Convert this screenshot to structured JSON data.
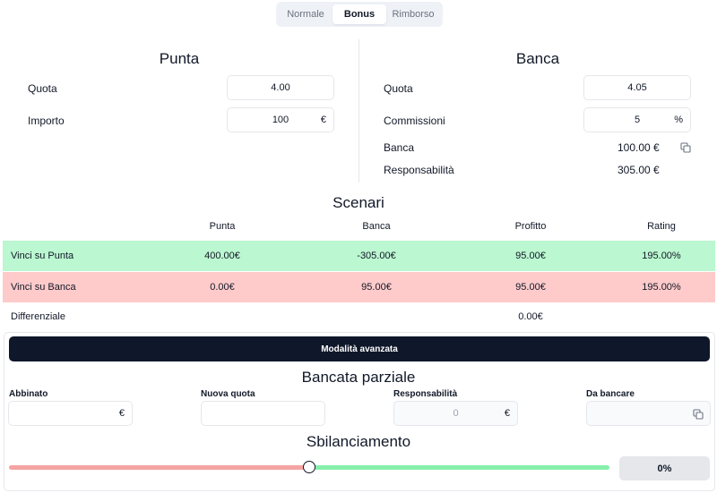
{
  "tabs": [
    {
      "label": "Normale",
      "active": false
    },
    {
      "label": "Bonus",
      "active": true
    },
    {
      "label": "Rimborso",
      "active": false
    }
  ],
  "punta": {
    "title": "Punta",
    "quota_label": "Quota",
    "quota_value": "4.00",
    "importo_label": "Importo",
    "importo_value": "100",
    "importo_suffix": "€"
  },
  "banca": {
    "title": "Banca",
    "quota_label": "Quota",
    "quota_value": "4.05",
    "commissioni_label": "Commissioni",
    "commissioni_value": "5",
    "commissioni_suffix": "%",
    "banca_label": "Banca",
    "banca_value": "100.00 €",
    "responsabilita_label": "Responsabilità",
    "responsabilita_value": "305.00 €"
  },
  "scenari": {
    "title": "Scenari",
    "headers": [
      "Punta",
      "Banca",
      "Profitto",
      "Rating"
    ],
    "rows": [
      {
        "label": "Vinci su Punta",
        "punta": "400.00€",
        "banca": "-305.00€",
        "profitto": "95.00€",
        "rating": "195.00%",
        "color": "#bbf7d0"
      },
      {
        "label": "Vinci su Banca",
        "punta": "0.00€",
        "banca": "95.00€",
        "profitto": "95.00€",
        "rating": "195.00%",
        "color": "#fecaca"
      }
    ],
    "differenziale_label": "Differenziale",
    "differenziale_value": "0.00€"
  },
  "advanced": {
    "button_label": "Modalità avanzata",
    "bancata_title": "Bancata parziale",
    "abbinato_label": "Abbinato",
    "abbinato_value": "",
    "abbinato_suffix": "€",
    "nuova_quota_label": "Nuova quota",
    "nuova_quota_value": "",
    "responsabilita_label": "Responsabilità",
    "responsabilita_value": "0",
    "responsabilita_suffix": "€",
    "da_bancare_label": "Da bancare",
    "da_bancare_value": ""
  },
  "sbilanciamento": {
    "title": "Sbilanciamento",
    "value_label": "0%",
    "slider_fraction": 0.5,
    "left_color": "#f5a3a3",
    "right_color": "#86efac"
  },
  "icons": {
    "copy": "copy-icon"
  }
}
